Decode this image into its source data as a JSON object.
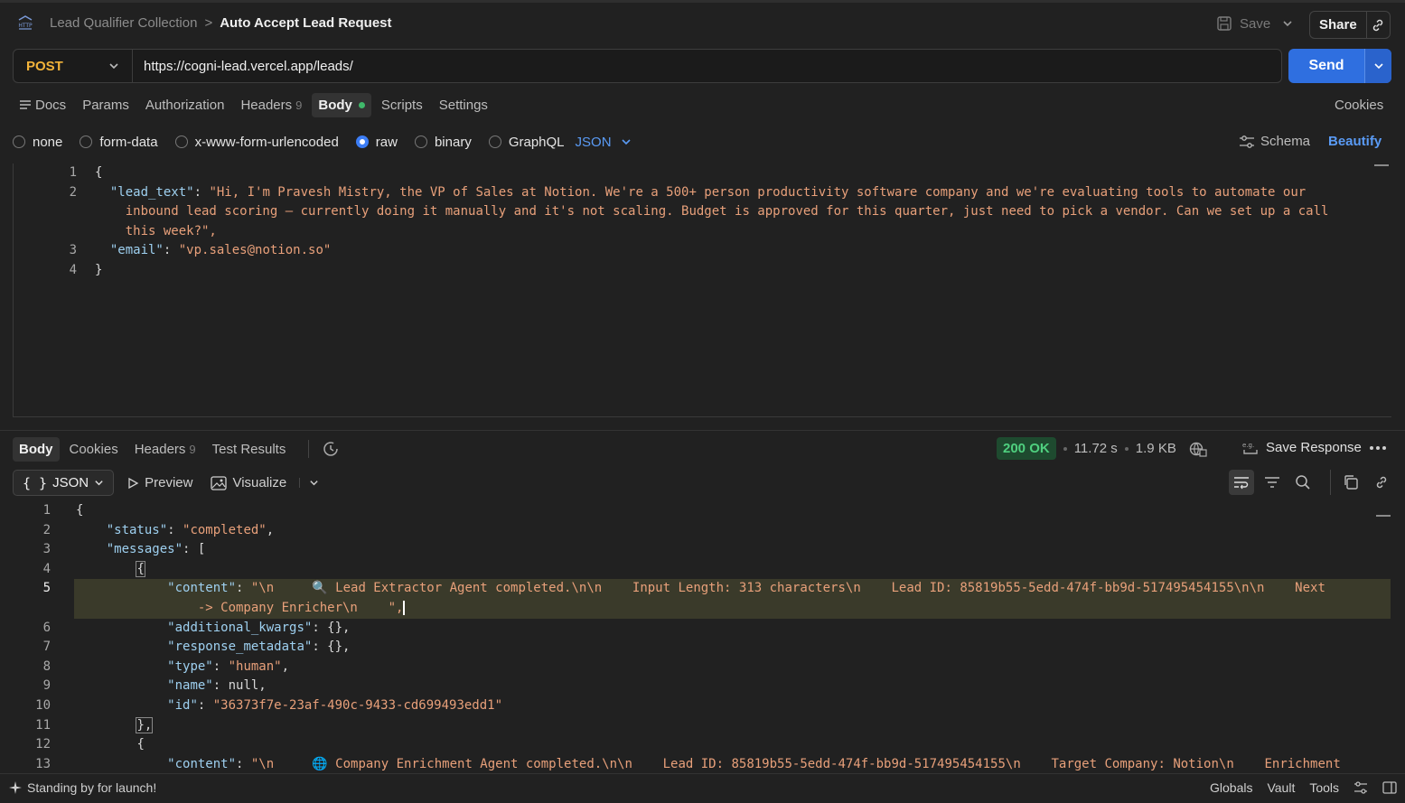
{
  "breadcrumb": {
    "parent": "Lead Qualifier Collection",
    "separator": ">",
    "current": "Auto Accept Lead Request"
  },
  "header": {
    "save_label": "Save",
    "share_label": "Share"
  },
  "request": {
    "method": "POST",
    "url": "https://cogni-lead.vercel.app/leads/",
    "send_label": "Send",
    "tabs": [
      {
        "label": "Docs"
      },
      {
        "label": "Params"
      },
      {
        "label": "Authorization"
      },
      {
        "label": "Headers",
        "count": "9"
      },
      {
        "label": "Body"
      },
      {
        "label": "Scripts"
      },
      {
        "label": "Settings"
      }
    ],
    "cookies_label": "Cookies",
    "body_types": [
      "none",
      "form-data",
      "x-www-form-urlencoded",
      "raw",
      "binary",
      "GraphQL"
    ],
    "body_format": "JSON",
    "schema_label": "Schema",
    "beautify_label": "Beautify",
    "body_lines": [
      {
        "num": "1",
        "text": "{"
      },
      {
        "num": "2",
        "key": "\"lead_text\"",
        "value": "\"Hi, I'm Pravesh Mistry, the VP of Sales at Notion. We're a 500+ person productivity software company and we're evaluating tools to automate our",
        "cont": [
          "inbound lead scoring – currently doing it manually and it's not scaling. Budget is approved for this quarter, just need to pick a vendor. Can we set up a call",
          "this week?\","
        ]
      },
      {
        "num": "3",
        "key": "\"email\"",
        "value": "\"vp.sales@notion.so\""
      },
      {
        "num": "4",
        "text": "}"
      }
    ]
  },
  "response": {
    "tabs": [
      {
        "label": "Body"
      },
      {
        "label": "Cookies"
      },
      {
        "label": "Headers",
        "count": "9"
      },
      {
        "label": "Test Results"
      }
    ],
    "status": "200 OK",
    "time": "11.72 s",
    "size": "1.9 KB",
    "save_response_label": "Save Response",
    "format": "JSON",
    "preview_label": "Preview",
    "visualize_label": "Visualize",
    "lines": [
      {
        "num": "1",
        "indent": 0,
        "text": "{"
      },
      {
        "num": "2",
        "indent": 1,
        "key": "\"status\"",
        "value": "\"completed\"",
        "tail": ","
      },
      {
        "num": "3",
        "indent": 1,
        "key": "\"messages\"",
        "raw": "["
      },
      {
        "num": "4",
        "indent": 2,
        "text": "{"
      },
      {
        "num": "5",
        "indent": 3,
        "key": "\"content\"",
        "value": "\"\\n     🔍 Lead Extractor Agent completed.\\n\\n    Input Length: 313 characters\\n    Lead ID: 85819b55-5edd-474f-bb9d-517495454155\\n\\n    Next",
        "cont": "-> Company Enricher\\n    \",",
        "highlight": true
      },
      {
        "num": "6",
        "indent": 3,
        "key": "\"additional_kwargs\"",
        "raw": "{},",
        "lit": true
      },
      {
        "num": "7",
        "indent": 3,
        "key": "\"response_metadata\"",
        "raw": "{},",
        "lit": true
      },
      {
        "num": "8",
        "indent": 3,
        "key": "\"type\"",
        "value": "\"human\"",
        "tail": ","
      },
      {
        "num": "9",
        "indent": 3,
        "key": "\"name\"",
        "raw": "null,",
        "lit": true
      },
      {
        "num": "10",
        "indent": 3,
        "key": "\"id\"",
        "value": "\"36373f7e-23af-490c-9433-cd699493edd1\""
      },
      {
        "num": "11",
        "indent": 2,
        "text": "},"
      },
      {
        "num": "12",
        "indent": 2,
        "text": "{"
      },
      {
        "num": "13",
        "indent": 3,
        "key": "\"content\"",
        "value": "\"\\n     🌐 Company Enrichment Agent completed.\\n\\n    Lead ID: 85819b55-5edd-474f-bb9d-517495454155\\n    Target Company: Notion\\n    Enrichment"
      }
    ]
  },
  "statusbar": {
    "launch_text": "Standing by for launch!",
    "items": [
      "Globals",
      "Vault",
      "Tools"
    ]
  }
}
